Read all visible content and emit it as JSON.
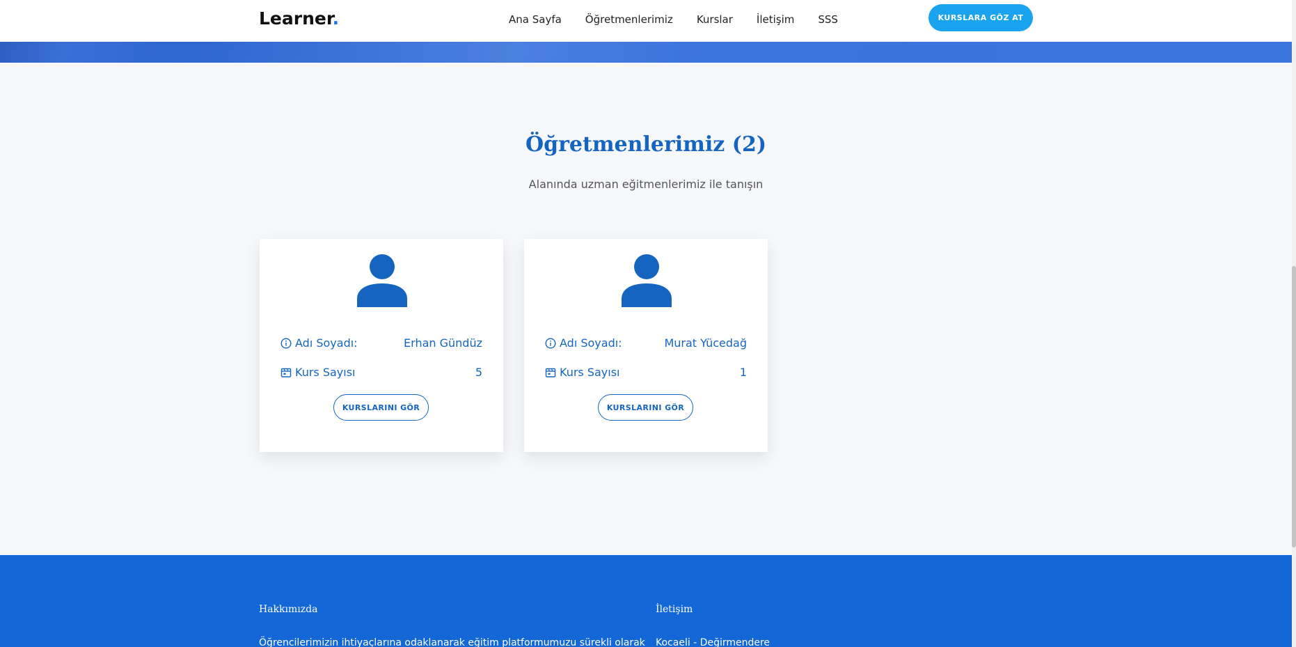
{
  "header": {
    "logo_text": "Learner",
    "logo_dot": ".",
    "nav": [
      "Ana Sayfa",
      "Öğretmenlerimiz",
      "Kurslar",
      "İletişim",
      "SSS"
    ],
    "cta_label": "KURSLARA GÖZ AT"
  },
  "section": {
    "title": "Öğretmenlerimiz (2)",
    "subtitle": "Alanında uzman eğitmenlerimiz ile tanışın"
  },
  "teachers": [
    {
      "name_label": "Adı Soyadı:",
      "name": "Erhan Gündüz",
      "count_label": "Kurs Sayısı",
      "count": "5",
      "button": "KURSLARINI GÖR"
    },
    {
      "name_label": "Adı Soyadı:",
      "name": "Murat Yücedağ",
      "count_label": "Kurs Sayısı",
      "count": "1",
      "button": "KURSLARINI GÖR"
    }
  ],
  "footer": {
    "about_title": "Hakkımızda",
    "about_text": "Öğrencilerimizin ihtiyaçlarına odaklanarak eğitim platformumuzu sürekli olarak",
    "contact_title": "İletişim",
    "contact_text": "Kocaeli - Değirmendere"
  },
  "colors": {
    "primary": "#1565c0",
    "cta": "#1aa3ee",
    "footer": "#1467d6",
    "background": "#f6f8fb"
  }
}
